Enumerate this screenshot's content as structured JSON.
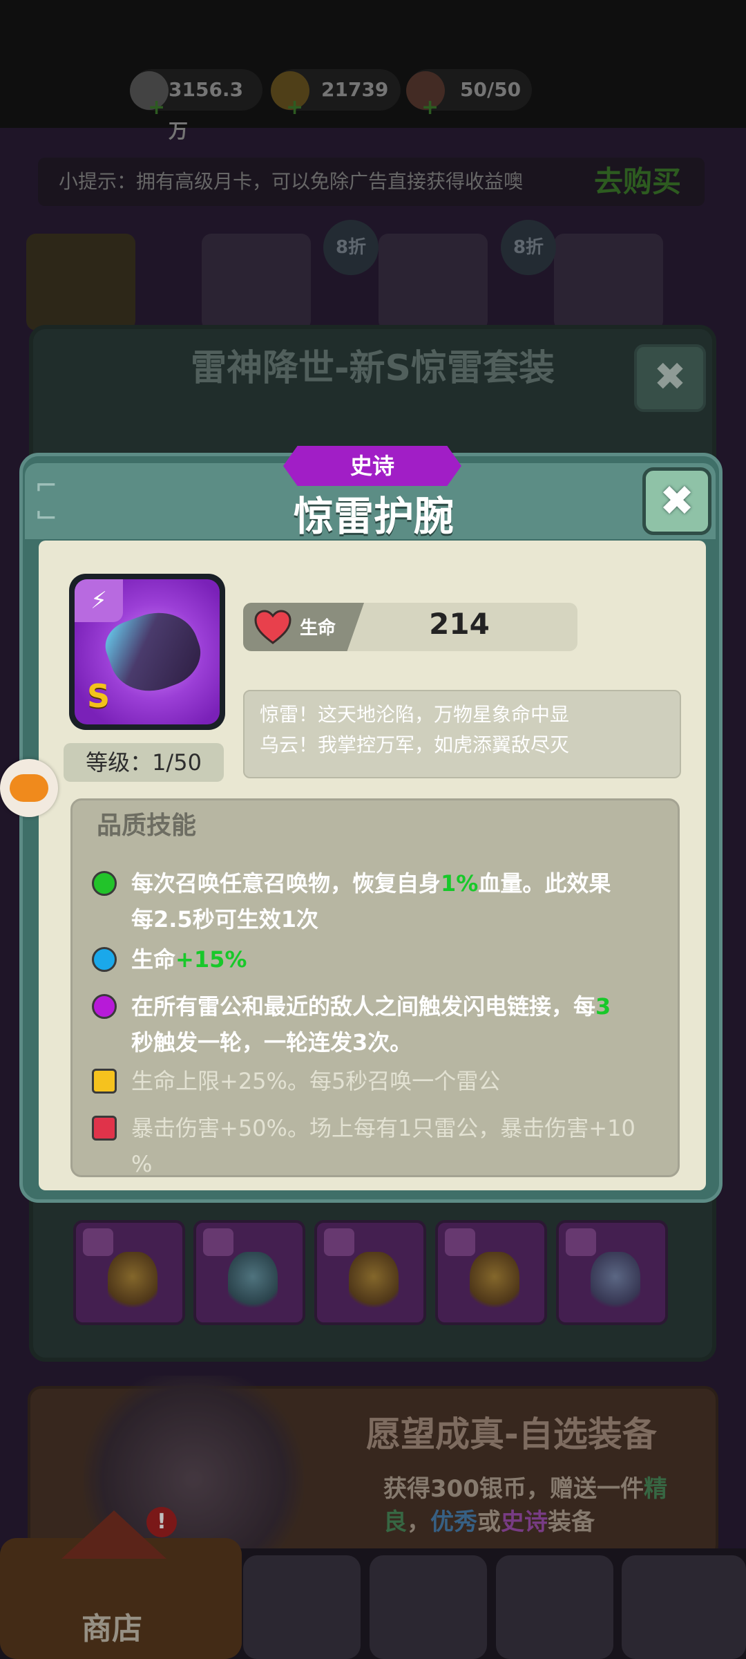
{
  "resources": {
    "silver": "3156.3万",
    "gold": "21739",
    "stamina": "50/50"
  },
  "tip": {
    "text": "小提示：拥有高级月卡，可以免除广告直接获得收益噢",
    "buy_label": "去购买"
  },
  "discount_badges": [
    "8折",
    "8折"
  ],
  "set_dialog": {
    "title": "雷神降世-新S惊雷套装"
  },
  "item": {
    "rarity": "史诗",
    "name": "惊雷护腕",
    "grade_letter": "S",
    "level_text": "等级：1/50",
    "stat_label": "生命",
    "stat_value": "214",
    "flavor_line1": "惊雷！这天地沦陷，万物星象命中显",
    "flavor_line2": "乌云！我掌控万军，如虎添翼敌尽灭"
  },
  "skills": {
    "title": "品质技能",
    "s1_a": "每次召唤任意召唤物，恢复自身",
    "s1_hl": "1%",
    "s1_b": "血量。此效果",
    "s1_line2": "每2.5秒可生效1次",
    "s2_a": "生命",
    "s2_hl": "+15%",
    "s3_a": "在所有雷公和最近的敌人之间触发闪电链接，每",
    "s3_hl": "3",
    "s3_line2": "秒触发一轮，一轮连发3次。",
    "s4": "生命上限+25%。每5秒召唤一个雷公",
    "s5_line1": "暴击伤害+50%。场上每有1只雷公，暴击伤害+10",
    "s5_line2": "%"
  },
  "wish": {
    "title": "愿望成真-自选装备",
    "desc_a": "获得300银币，赠送一件",
    "desc_g": "精",
    "desc_line2_g": "良",
    "desc_sep": "，",
    "desc_b": "优秀",
    "desc_or": "或",
    "desc_p": "史诗",
    "desc_end": "装备"
  },
  "nav": {
    "shop_label": "商店"
  },
  "colors": {
    "rarity_epic": "#a11ec6",
    "highlight_green": "#18c82a",
    "dot_green": "#22c32a",
    "dot_blue": "#1aa8ea",
    "dot_purple": "#b71ad8",
    "lock_yellow": "#f5c21e",
    "lock_red": "#e0334a"
  },
  "icons": [
    "silver-coin-icon",
    "gold-ingot-icon",
    "meat-icon",
    "close-icon",
    "heart-icon",
    "gamepad-icon",
    "lock-icon",
    "lightning-icon"
  ]
}
